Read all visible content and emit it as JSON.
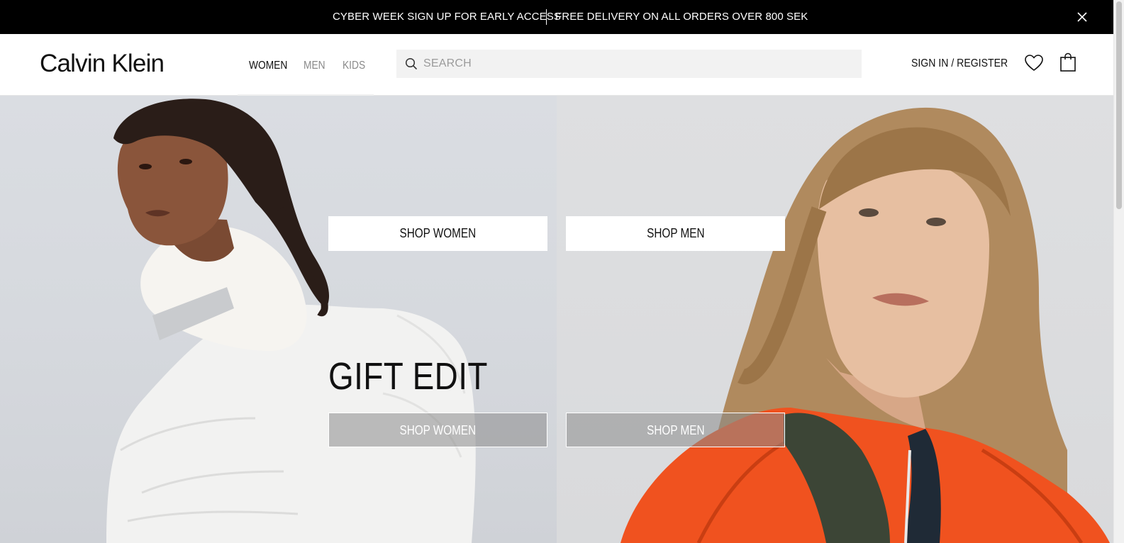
{
  "promo": {
    "left_text": "CYBER WEEK SIGN UP FOR EARLY ACCESS",
    "right_text": "FREE DELIVERY ON ALL ORDERS OVER 800 SEK",
    "close_icon": "close-icon"
  },
  "header": {
    "logo": "Calvin Klein",
    "nav": [
      "WOMEN",
      "MEN",
      "KIDS"
    ],
    "active_nav": "WOMEN",
    "search_placeholder": "SEARCH",
    "search_value": "",
    "signin": "SIGN IN / REGISTER",
    "icons": [
      "search-icon",
      "heart-icon",
      "shopping-bag-icon"
    ]
  },
  "hero": {
    "title": "GIFT EDIT",
    "top_buttons": {
      "women": "SHOP WOMEN",
      "men": "SHOP MEN"
    },
    "bottom_buttons": {
      "women": "SHOP WOMEN",
      "men": "SHOP MEN"
    }
  },
  "colors": {
    "promo_bg": "#000000",
    "search_bg": "#f2f2f2",
    "jacket_orange": "#f0521f",
    "nav_inactive": "#8a8a8a"
  }
}
